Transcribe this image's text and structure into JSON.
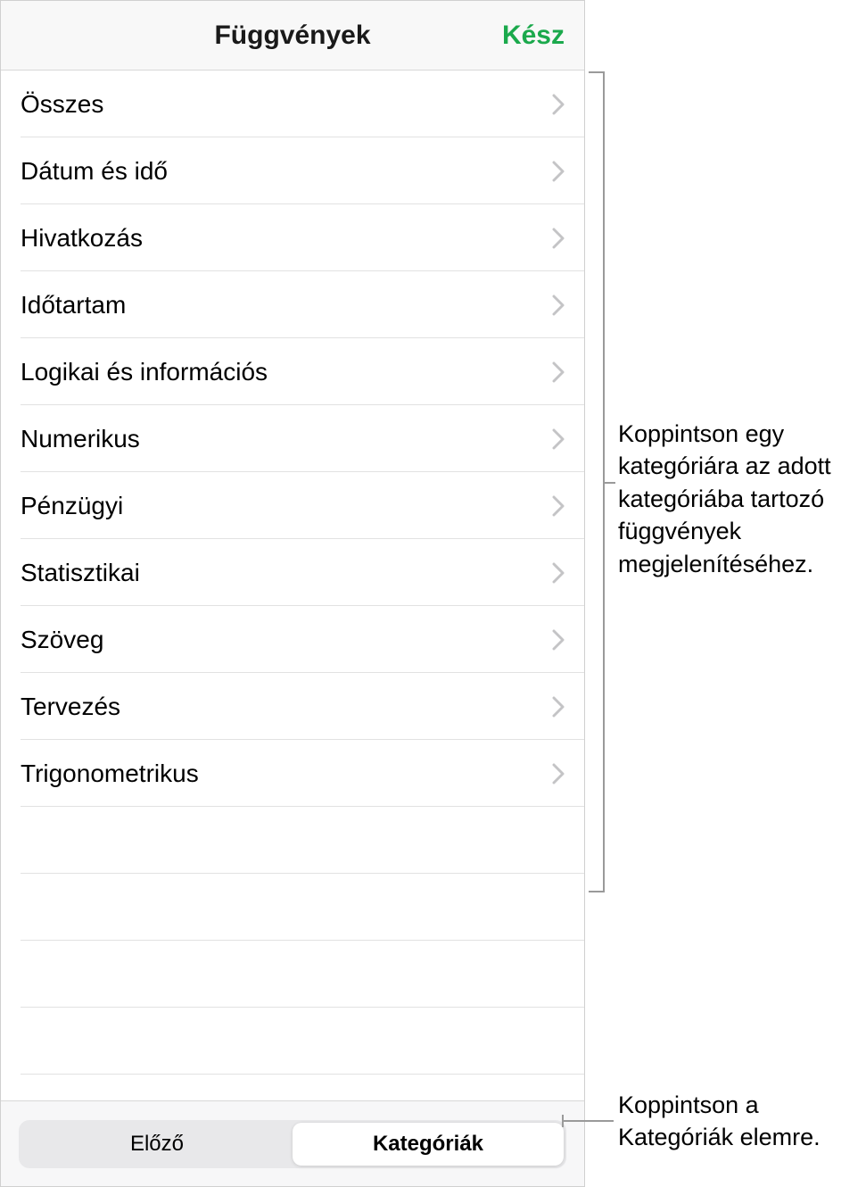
{
  "panel": {
    "title": "Függvények",
    "done_label": "Kész",
    "categories": [
      {
        "label": "Összes"
      },
      {
        "label": "Dátum és idő"
      },
      {
        "label": "Hivatkozás"
      },
      {
        "label": "Időtartam"
      },
      {
        "label": "Logikai és információs"
      },
      {
        "label": "Numerikus"
      },
      {
        "label": "Pénzügyi"
      },
      {
        "label": "Statisztikai"
      },
      {
        "label": "Szöveg"
      },
      {
        "label": "Tervezés"
      },
      {
        "label": "Trigonometrikus"
      }
    ],
    "footer": {
      "previous_label": "Előző",
      "categories_label": "Kategóriák"
    }
  },
  "callouts": {
    "list_hint": "Koppintson egy kategóriára az adott kategóriába tartozó függvények megjelenítéséhez.",
    "footer_hint": "Koppintson a Kategóriák elemre."
  }
}
